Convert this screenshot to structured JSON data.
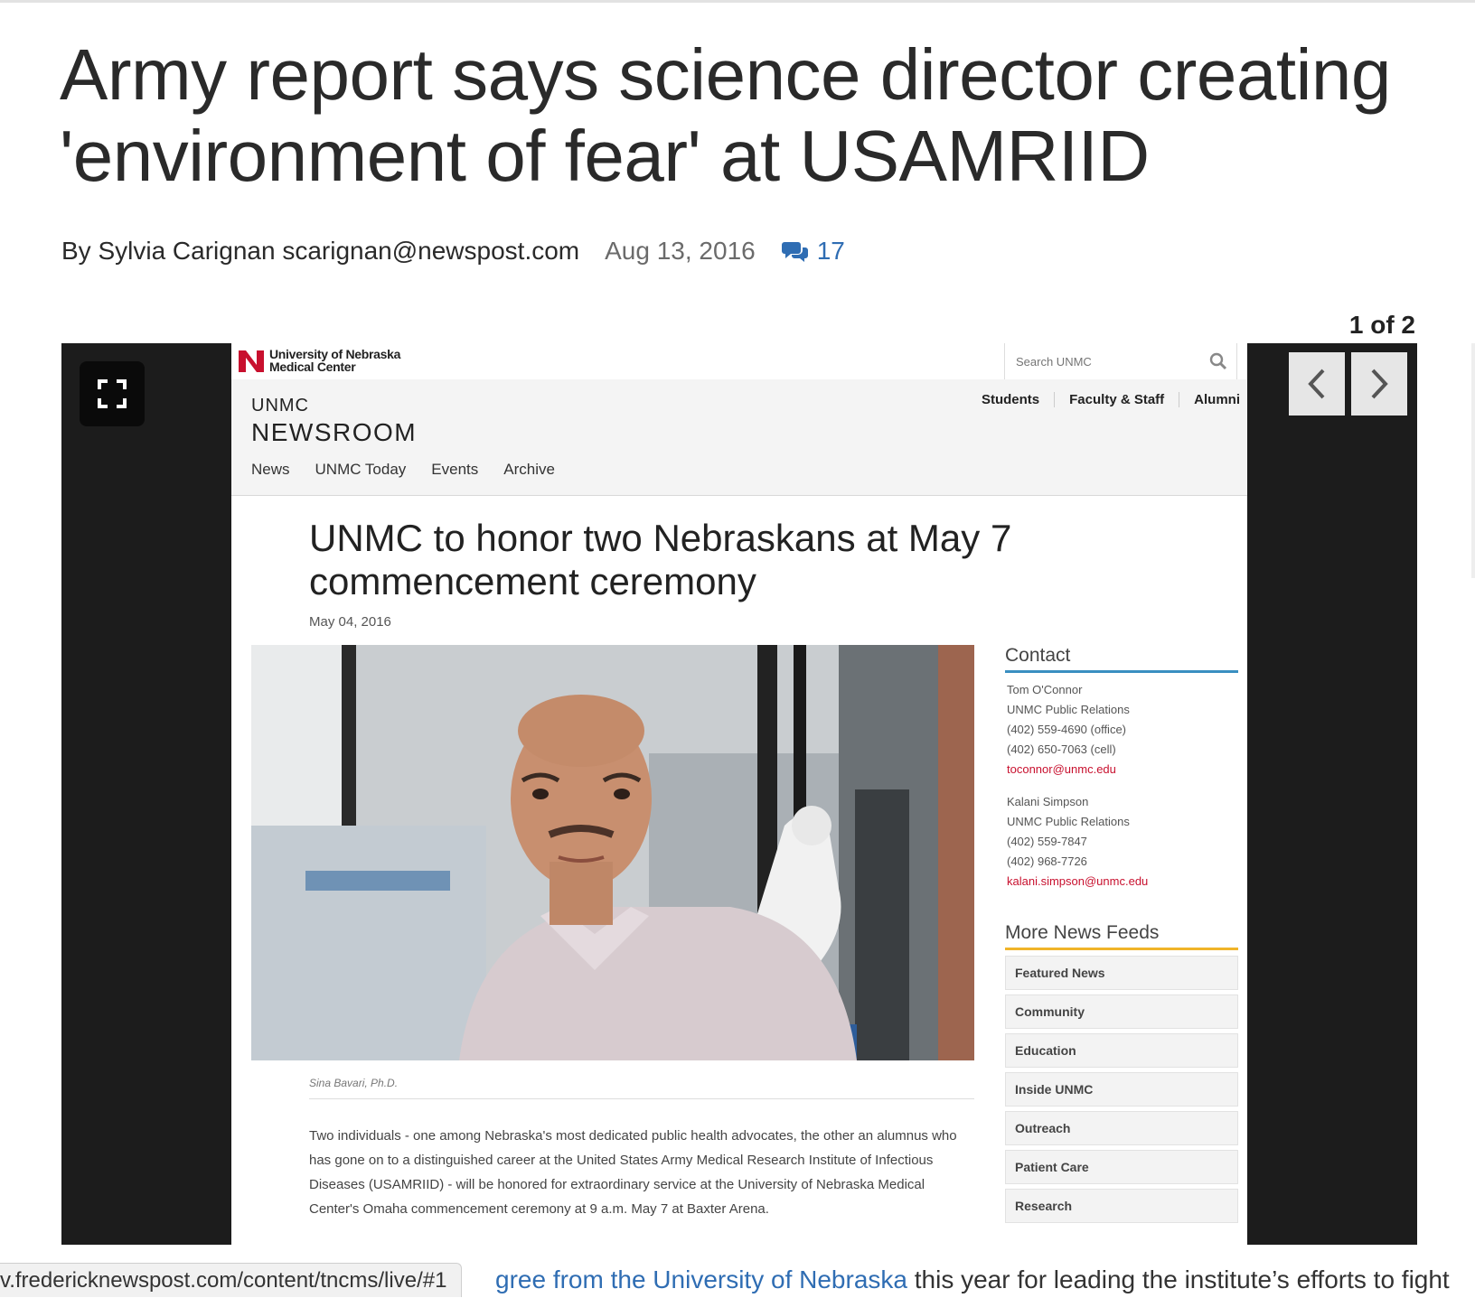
{
  "article": {
    "headline_line1": "Army report says science director creating",
    "headline_line2": "'environment of fear' at USAMRIID",
    "byline": "By Sylvia Carignan scarignan@newspost.com",
    "date": "Aug 13, 2016",
    "comment_count": "17"
  },
  "gallery": {
    "counter": "1 of 2"
  },
  "screenshot": {
    "logo_line1": "University of Nebraska",
    "logo_line2": "Medical Center",
    "search_placeholder": "Search UNMC",
    "site_name_l1": "UNMC",
    "site_name_l2": "NEWSROOM",
    "audience_links": [
      "Students",
      "Faculty & Staff",
      "Alumni"
    ],
    "nav_items": [
      "News",
      "UNMC Today",
      "Events",
      "Archive"
    ],
    "title": "UNMC to honor two Nebraskans at May 7 commencement ceremony",
    "date": "May 04, 2016",
    "caption": "Sina Bavari, Ph.D.",
    "body": "Two individuals - one among Nebraska's most dedicated public health advocates, the other an alumnus who has gone on to a distinguished career at the United States Army Medical Research Institute of Infectious Diseases (USAMRIID) - will be honored for extraordinary service at the University of Nebraska Medical Center's Omaha commencement ceremony at 9 a.m. May 7 at Baxter Arena.",
    "contact_heading": "Contact",
    "contact1": {
      "name": "Tom O'Connor",
      "org": "UNMC Public Relations",
      "phone1": "(402) 559-4690 (office)",
      "phone2": "(402) 650-7063 (cell)",
      "email": "toconnor@unmc.edu"
    },
    "contact2": {
      "name": "Kalani Simpson",
      "org": "UNMC Public Relations",
      "phone1": "(402) 559-7847",
      "phone2": "(402) 968-7726",
      "email": "kalani.simpson@unmc.edu"
    },
    "feeds_heading": "More News Feeds",
    "feeds": [
      "Featured News",
      "Community",
      "Education",
      "Inside UNMC",
      "Outreach",
      "Patient Care",
      "Research"
    ]
  },
  "status_bar": {
    "url": "v.fredericknewspost.com/content/tncms/live/#1"
  },
  "body_line": {
    "link_text": "gree from the University of Nebraska",
    "rest": " this year for leading the institute’s efforts to fight"
  },
  "colors": {
    "link_blue": "#2f6db3",
    "unmc_red": "#c8102e",
    "contact_rule": "#3a8fc1",
    "feeds_rule": "#f0b429"
  }
}
